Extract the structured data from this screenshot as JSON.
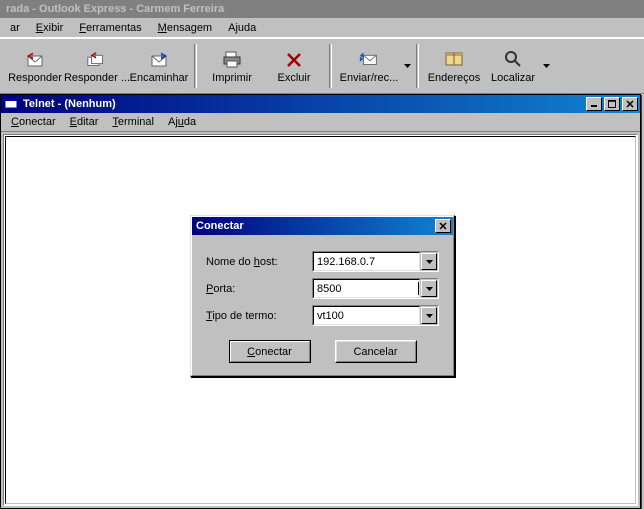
{
  "outlook": {
    "title": "rada - Outlook Express - Carmem Ferreira",
    "menu": [
      "ar",
      "Exibir",
      "Ferramentas",
      "Mensagem",
      "Ajuda"
    ],
    "toolbar": {
      "responder": "Responder",
      "responder_todos": "Responder ...",
      "encaminhar": "Encaminhar",
      "imprimir": "Imprimir",
      "excluir": "Excluir",
      "enviar_rec": "Enviar/rec...",
      "enderecos": "Endereços",
      "localizar": "Localizar"
    }
  },
  "telnet": {
    "title": "Telnet - (Nenhum)",
    "menu": [
      "Conectar",
      "Editar",
      "Terminal",
      "Ajuda"
    ]
  },
  "dialog": {
    "title": "Conectar",
    "host_label": "Nome do host:",
    "host_value": "192.168.0.7",
    "port_label": "Porta:",
    "port_value": "8500",
    "term_label": "Tipo de termo:",
    "term_value": "vt100",
    "ok": "Conectar",
    "cancel": "Cancelar"
  }
}
